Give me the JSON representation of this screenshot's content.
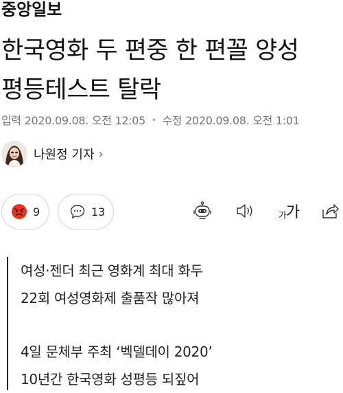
{
  "brand": {
    "logo_text": "중앙일보"
  },
  "article": {
    "headline_line1": "한국영화 두 편중 한 편꼴 양성",
    "headline_line2": "평등테스트 탈락",
    "input_label": "입력",
    "input_datetime": "2020.09.08. 오전 12:05",
    "modified_label": "수정",
    "modified_datetime": "2020.09.08. 오전 1:01",
    "reporter": "나원정 기자"
  },
  "actions": {
    "reaction_count": "9",
    "comment_count": "13",
    "fontsize_small": "가",
    "fontsize_large": "가"
  },
  "summary": {
    "lines_group1": [
      "여성·젠더 최근 영화계 최대 화두",
      "22회 여성영화제 출품작 많아져"
    ],
    "lines_group2": [
      "4일 문체부 주최 ‘벡델데이 2020’",
      "10년간 한국영화 성평등 되짚어"
    ]
  },
  "colors": {
    "reaction_face": "#e8361e",
    "text": "#111111",
    "meta": "#777777",
    "border": "#d4d4d4"
  },
  "icons": [
    "angry-face-icon",
    "speech-bubble-icon",
    "robot-icon",
    "speaker-icon",
    "font-size-icon",
    "share-icon",
    "chevron-right-icon"
  ]
}
